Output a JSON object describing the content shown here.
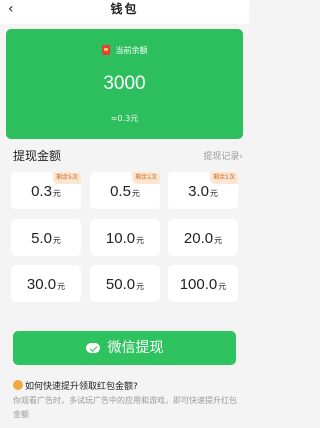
{
  "header": {
    "back_icon": "chevron-left-icon",
    "title": "钱包"
  },
  "balance_card": {
    "label": "当前余额",
    "amount": "3000",
    "equivalent": "≈0.3元",
    "color": "#2dbf5d"
  },
  "withdraw": {
    "section_title": "提现金额",
    "record_link": "提现记录›",
    "options": [
      {
        "value": "0.3",
        "unit": "元",
        "badge": "剩余5次"
      },
      {
        "value": "0.5",
        "unit": "元",
        "badge": "剩余1次"
      },
      {
        "value": "3.0",
        "unit": "元",
        "badge": "剩余1次"
      },
      {
        "value": "5.0",
        "unit": "元",
        "badge": ""
      },
      {
        "value": "10.0",
        "unit": "元",
        "badge": ""
      },
      {
        "value": "20.0",
        "unit": "元",
        "badge": ""
      },
      {
        "value": "30.0",
        "unit": "元",
        "badge": ""
      },
      {
        "value": "50.0",
        "unit": "元",
        "badge": ""
      },
      {
        "value": "100.0",
        "unit": "元",
        "badge": ""
      }
    ]
  },
  "wechat_button": {
    "label": "微信提现",
    "icon": "wechat-icon",
    "color": "#2ec35e"
  },
  "tips": {
    "title": "如何快速提升领取红包金额?",
    "description": "你观看广告时，多试玩广告中的应用和游戏，即可快速提升红包金额"
  }
}
